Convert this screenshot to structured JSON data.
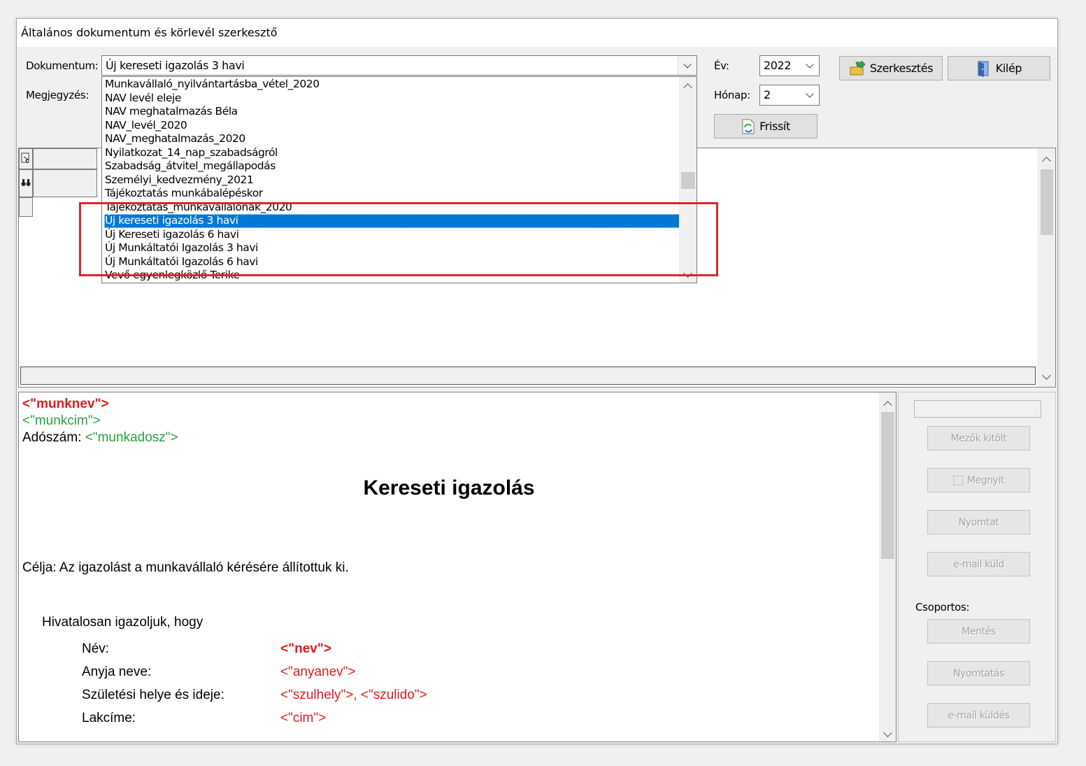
{
  "window": {
    "title": "Általános dokumentum és körlevél szerkesztő"
  },
  "form": {
    "document_label": "Dokumentum:",
    "document_value": "Új kereseti igazolás 3 havi",
    "note_label": "Megjegyzés:",
    "year_label": "Év:",
    "year_value": "2022",
    "month_label": "Hónap:",
    "month_value": "2",
    "edit_button": "Szerkesztés",
    "exit_button": "Kilép",
    "refresh_button": "Frissít"
  },
  "dropdown": {
    "items": [
      "Munkavállaló_nyilvántartásba_vétel_2020",
      "NAV levél eleje",
      "NAV meghatalmazás Béla",
      "NAV_levél_2020",
      "NAV_meghatalmazás_2020",
      "Nyilatkozat_14_nap_szabadságról",
      "Szabadság_átvitel_megállapodás",
      "Személyi_kedvezmény_2021",
      "Tájékoztatás munkábalépéskor",
      "Tájékoztatás_munkavállalónak_2020",
      "Új kereseti igazolás 3 havi",
      "Új Kereseti igazolás 6 havi",
      "Új Munkáltatói Igazolás 3 havi",
      "Új Munkáltatói Igazolás 6 havi",
      "Vevő egyenlegközlő Terike"
    ],
    "selected_index": 10,
    "highlight_color": "#0078d7",
    "annotation_color": "#d9262e"
  },
  "document": {
    "line1": "<\"munknev\">",
    "line2": "<\"munkcim\">",
    "tax_label": "Adószám:",
    "tax_value": "<\"munkadosz\">",
    "heading": "Kereseti igazolás",
    "purpose": "Célja: Az igazolást a munkavállaló kérésére állítottuk ki.",
    "intro": "Hivatalosan igazoljuk, hogy",
    "fields": [
      {
        "label": "Név:",
        "value": "<\"nev\">"
      },
      {
        "label": "Anyja neve:",
        "value": "<\"anyanev\">"
      },
      {
        "label": "Születési helye és ideje:",
        "value": "<\"szulhely\">, <\"szulido\">"
      },
      {
        "label": "Lakcíme:",
        "value": "<\"cim\">"
      }
    ]
  },
  "side_buttons": {
    "fill_fields": "Mezők kitölt",
    "open": "Megnyit",
    "print": "Nyomtat",
    "email_send": "e-mail küld",
    "group_label": "Csoportos:",
    "save": "Mentés",
    "print_group": "Nyomtatás",
    "email_group": "e-mail küldés"
  }
}
